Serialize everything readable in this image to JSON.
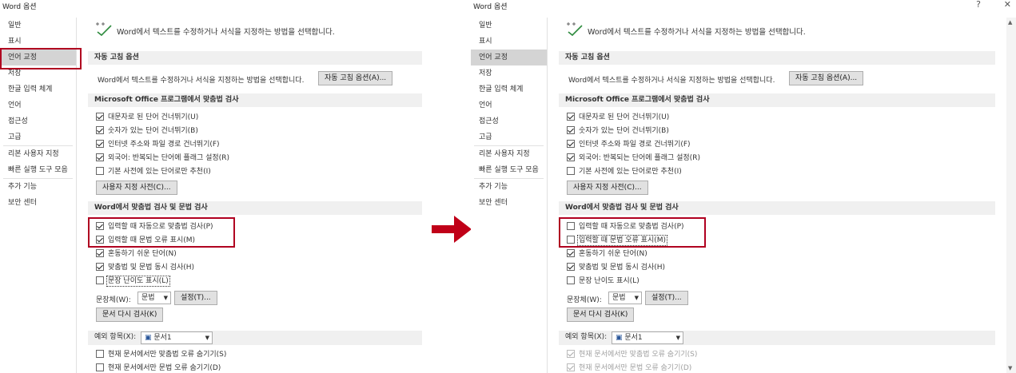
{
  "window_title": "Word 옵션",
  "title_buttons": {
    "help": "?",
    "close": "✕"
  },
  "nav_items": [
    "일반",
    "표시",
    "언어 교정",
    "저장",
    "한글 입력 체계",
    "언어",
    "접근성",
    "고급",
    "리본 사용자 지정",
    "빠른 실행 도구 모음",
    "추가 기능",
    "보안 센터"
  ],
  "header_text": "Word에서 텍스트를 수정하거나 서식을 지정하는 방법을 선택합니다.",
  "autocorrect": {
    "section": "자동 고침 옵션",
    "desc": "Word에서 텍스트를 수정하거나 서식을 지정하는 방법을 선택합니다.",
    "button": "자동 고침 옵션(A)..."
  },
  "office_spelling": {
    "section": "Microsoft Office 프로그램에서 맞춤법 검사",
    "items": [
      {
        "label": "대문자로 된 단어 건너뛰기(U)",
        "checked": true
      },
      {
        "label": "숫자가 있는 단어 건너뛰기(B)",
        "checked": true
      },
      {
        "label": "인터넷 주소와 파일 경로 건너뛰기(F)",
        "checked": true
      },
      {
        "label": "외국어: 반복되는 단어에 플래그 설정(R)",
        "checked": true
      },
      {
        "label": "기본 사전에 있는 단어로만 추천(I)",
        "checked": false
      }
    ],
    "custom_dict_button": "사용자 지정 사전(C)..."
  },
  "word_spelling": {
    "section": "Word에서 맞춤법 검사 및 문법 검사",
    "items": [
      {
        "label": "입력할 때 자동으로 맞춤법 검사(P)"
      },
      {
        "label": "입력할 때 문법 오류 표시(M)"
      },
      {
        "label": "혼동하기 쉬운 단어(N)"
      },
      {
        "label": "맞춤법 및 문법 동시 검사(H)"
      },
      {
        "label": "문장 난이도 표시(L)"
      }
    ],
    "left_checked": [
      true,
      true,
      true,
      true,
      false
    ],
    "right_checked": [
      false,
      false,
      true,
      true,
      false
    ],
    "style_label": "문장체(W):",
    "style_value": "문법",
    "settings_button": "설정(T)...",
    "recheck_button": "문서 다시 검사(K)"
  },
  "exceptions": {
    "label": "예외 항목(X):",
    "doc_value": "문서1",
    "items": [
      {
        "label": "현재 문서에서만 맞춤법 오류 숨기기(S)"
      },
      {
        "label": "현재 문서에서만 문법 오류 숨기기(D)"
      }
    ],
    "left_checked": [
      false,
      false
    ],
    "right_checked": [
      true,
      true
    ]
  },
  "colors": {
    "highlight_box": "#b00020",
    "arrow": "#c00018",
    "nav_active": "#d4d4d4"
  }
}
